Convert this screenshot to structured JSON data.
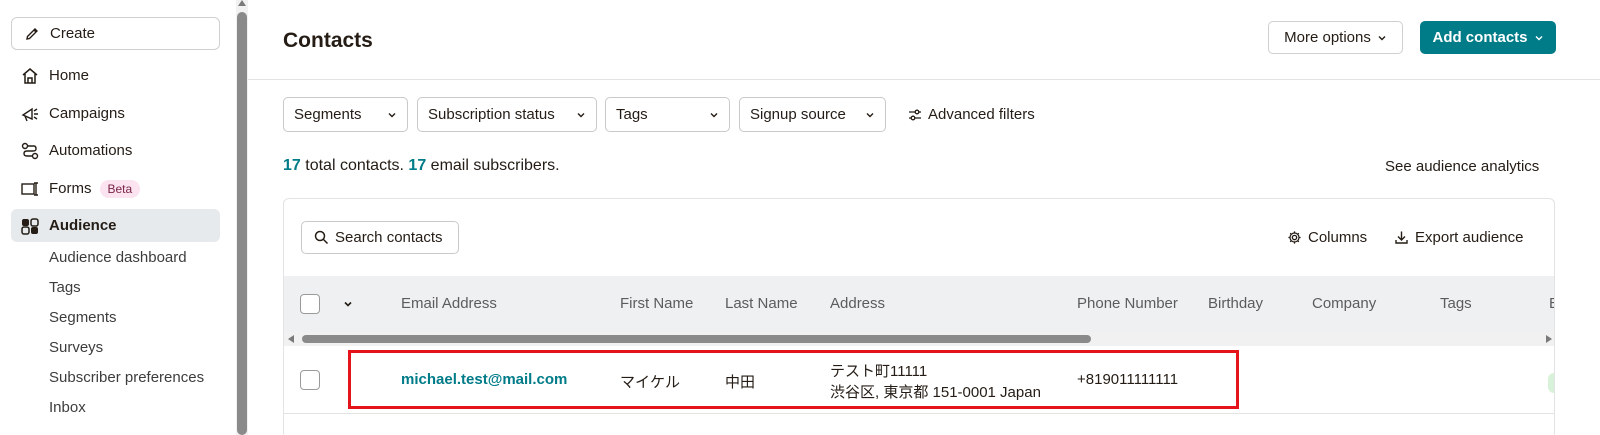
{
  "sidebar": {
    "create_label": "Create",
    "items": [
      {
        "label": "Home",
        "icon": "home-icon"
      },
      {
        "label": "Campaigns",
        "icon": "megaphone-icon"
      },
      {
        "label": "Automations",
        "icon": "automation-icon"
      },
      {
        "label": "Forms",
        "icon": "form-icon",
        "badge": "Beta"
      },
      {
        "label": "Audience",
        "icon": "audience-icon",
        "active": true
      }
    ],
    "sub_items": [
      "Audience dashboard",
      "Tags",
      "Segments",
      "Surveys",
      "Subscriber preferences",
      "Inbox"
    ]
  },
  "header": {
    "title": "Contacts",
    "more_options_label": "More options",
    "add_contacts_label": "Add contacts"
  },
  "filters": {
    "segments": "Segments",
    "subscription_status": "Subscription status",
    "tags": "Tags",
    "signup_source": "Signup source",
    "advanced": "Advanced filters"
  },
  "summary": {
    "total_count": "17",
    "total_text": "total contacts.",
    "email_count": "17",
    "email_text": "email subscribers.",
    "analytics_link": "See audience analytics"
  },
  "table": {
    "search_label": "Search contacts",
    "columns_label": "Columns",
    "export_label": "Export audience",
    "headers": [
      "Email Address",
      "First Name",
      "Last Name",
      "Address",
      "Phone Number",
      "Birthday",
      "Company",
      "Tags",
      "E"
    ],
    "rows": [
      {
        "email": "michael.test@mail.com",
        "first_name": "マイケル",
        "last_name": "中田",
        "address_line1": "テスト町11111",
        "address_line2": "渋谷区, 東京都 151-0001 Japan",
        "phone": "+819011111111"
      }
    ]
  },
  "colors": {
    "accent": "#007c89",
    "highlight": "#e5141a",
    "active_bg": "#e6eaed"
  }
}
